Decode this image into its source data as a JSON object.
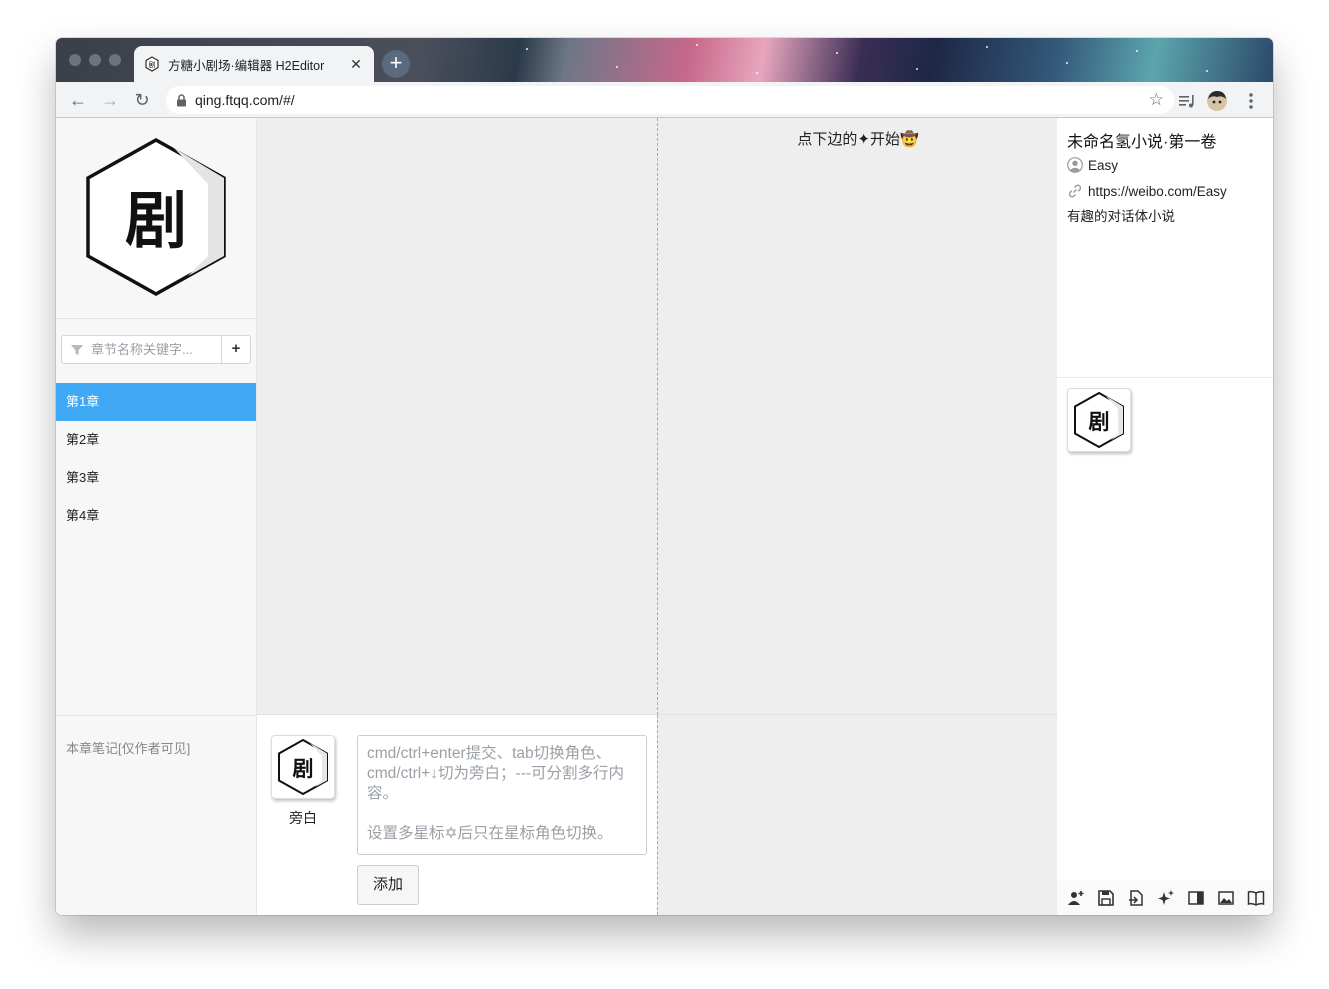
{
  "browser": {
    "tab_title": "方糖小剧场·编辑器 H2Editor",
    "tab_close": "✕",
    "new_tab": "+",
    "url": "qing.ftqq.com/#/",
    "back": "←",
    "forward": "→",
    "reload": "↻",
    "bookmark": "☆"
  },
  "sidebar": {
    "search_placeholder": "章节名称关键字...",
    "add_label": "+",
    "chapters": [
      "第1章",
      "第2章",
      "第3章",
      "第4章"
    ],
    "active_chapter_index": 0,
    "notes_label": "本章笔记[仅作者可见]"
  },
  "stage": {
    "start_hint": "点下边的✦开始🤠"
  },
  "editor": {
    "role_name": "旁白",
    "input_placeholder": "cmd/ctrl+enter提交、tab切换角色、cmd/ctrl+↓切为旁白；---可分割多行内容。\n\n设置多星标✡后只在星标角色切换。",
    "submit_label": "添加"
  },
  "book": {
    "title": "未命名氢小说·第一卷",
    "author": "Easy",
    "link": "https://weibo.com/Easy",
    "description": "有趣的对话体小说"
  },
  "logo_glyph": "剧",
  "tools": [
    "add-role-icon",
    "save-icon",
    "export-icon",
    "sparkle-icon",
    "layout-icon",
    "image-icon",
    "book-icon"
  ],
  "colors": {
    "accent": "#3fa9f5",
    "stage_bg": "#eeeeee"
  }
}
